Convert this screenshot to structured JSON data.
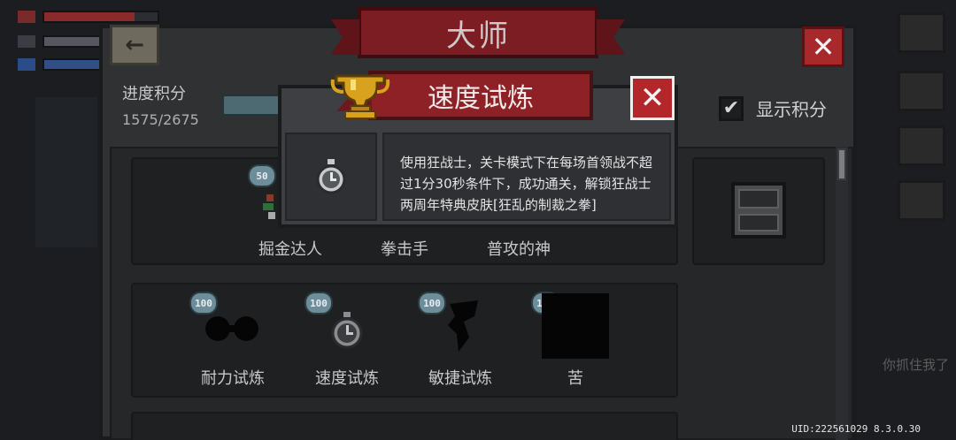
{
  "panel": {
    "title": "大师",
    "progress_label": "进度积分",
    "progress_value": "1575/2675",
    "show_score_label": "显示积分",
    "show_score_checked": "✔"
  },
  "achievements": {
    "row1": [
      {
        "label": "掘金达人",
        "points": "50"
      },
      {
        "label": "拳击手"
      },
      {
        "label": "普攻的神"
      }
    ],
    "row2": [
      {
        "label": "耐力试炼",
        "points": "100"
      },
      {
        "label": "速度试炼",
        "points": "100"
      },
      {
        "label": "敏捷试炼",
        "points": "100"
      },
      {
        "label": "苦",
        "points": "100"
      }
    ]
  },
  "popup": {
    "title": "速度试炼",
    "description": "使用狂战士，关卡模式下在每场首领战不超过1分30秒条件下，成功通关，解锁狂战士两周年特典皮肤[狂乱的制裁之拳]"
  },
  "background": {
    "uid_text": "UID:222561029 8.3.0.30",
    "right_text": "你抓住我了"
  },
  "colors": {
    "ribbon_red": "#7b1d22",
    "badge_blue": "#6e8d9a",
    "panel_gray": "#2f3133"
  },
  "icons": {
    "back": "back-arrow-icon",
    "close": "close-x-icon",
    "trophy": "trophy-icon",
    "stopwatch": "stopwatch-icon",
    "check": "checkmark-icon",
    "chest": "chest-icon"
  }
}
